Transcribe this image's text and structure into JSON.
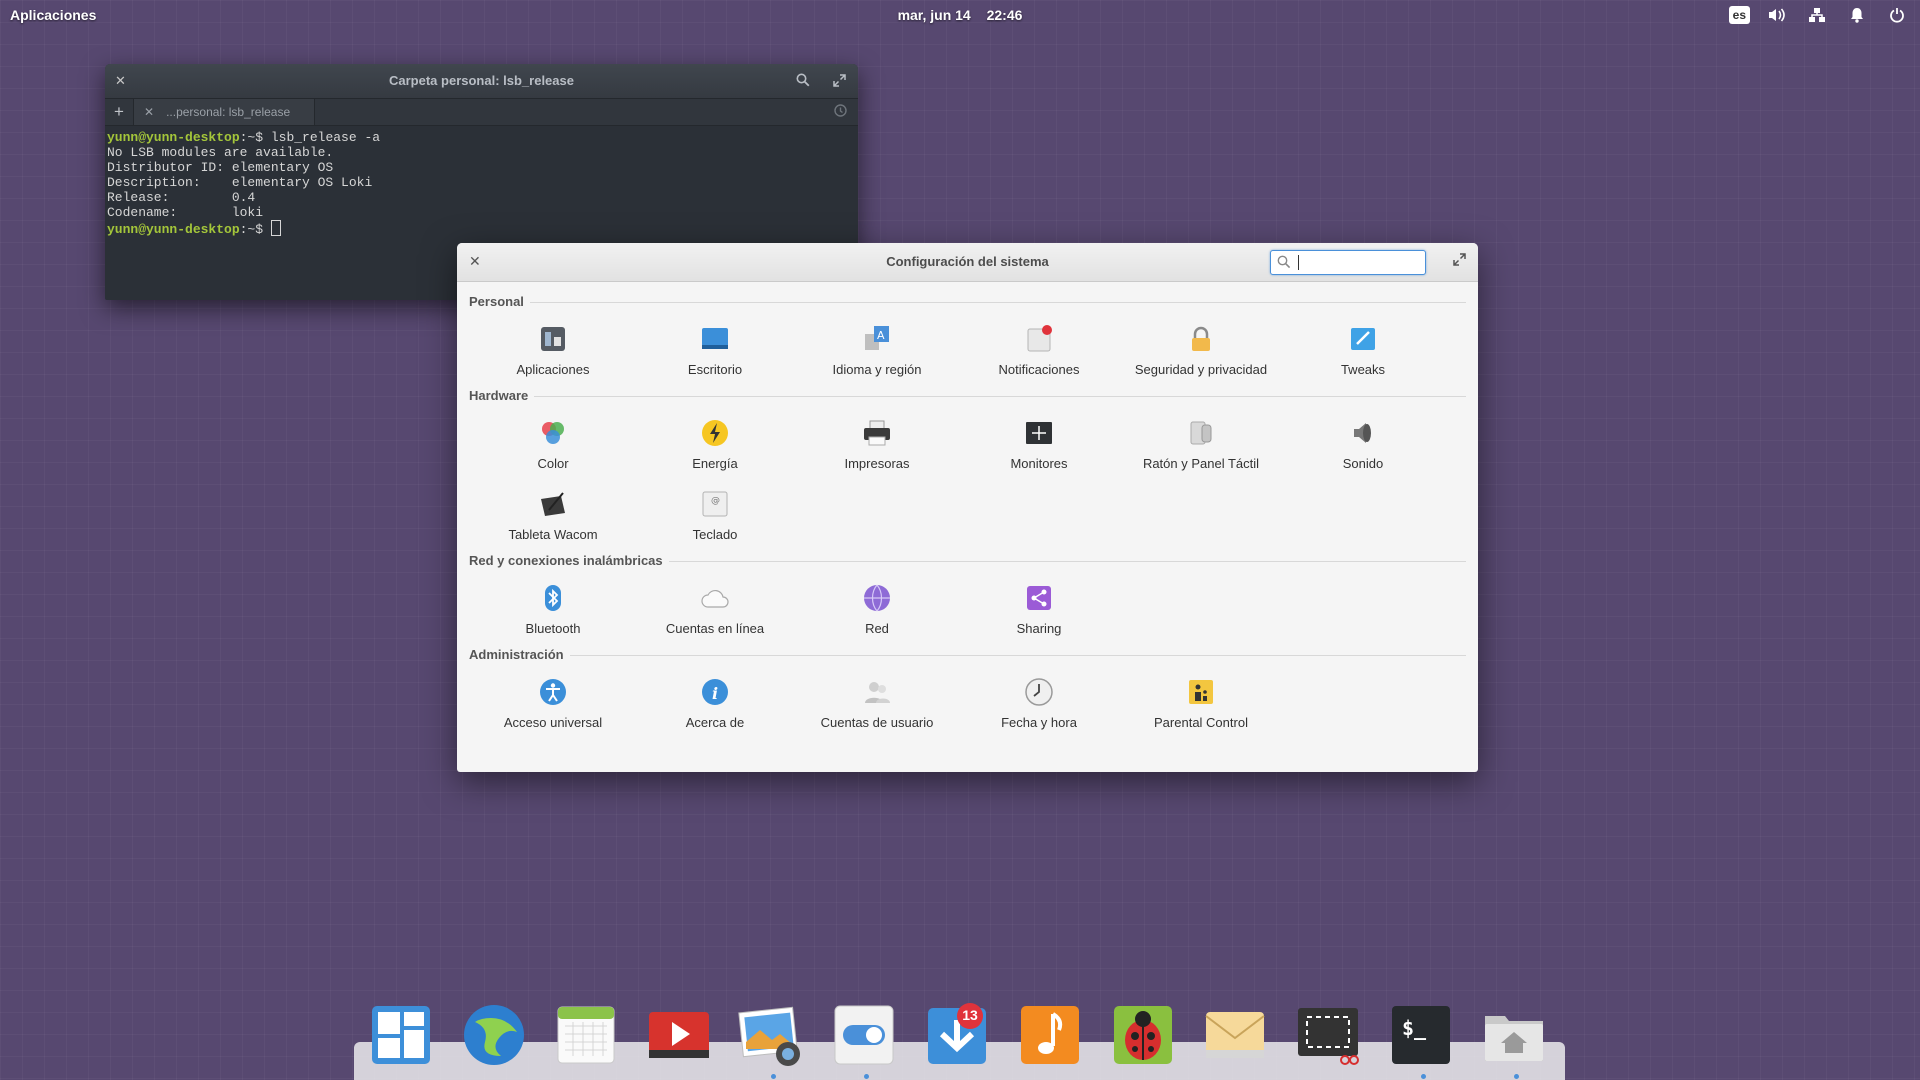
{
  "panel": {
    "applications": "Aplicaciones",
    "date": "mar, jun 14",
    "time": "22:46",
    "keyboard_layout": "es",
    "tray_icons": [
      "volume-icon",
      "network-icon",
      "notifications-icon",
      "power-icon"
    ]
  },
  "terminal": {
    "title": "Carpeta personal: lsb_release",
    "tab_label": "...personal: lsb_release",
    "lines": [
      {
        "prompt": "yunn@yunn-desktop",
        "suffix": ":~$ ",
        "text": "lsb_release -a"
      },
      {
        "text": "No LSB modules are available."
      },
      {
        "text": "Distributor ID:\telementary OS"
      },
      {
        "text": "Description:\telementary OS Loki"
      },
      {
        "text": "Release:\t0.4"
      },
      {
        "text": "Codename:\tloki"
      },
      {
        "prompt": "yunn@yunn-desktop",
        "suffix": ":~$ ",
        "text": ""
      }
    ]
  },
  "settings": {
    "title": "Configuración del sistema",
    "search": {
      "value": "",
      "placeholder": ""
    },
    "categories": [
      {
        "label": "Personal",
        "items": [
          {
            "label": "Aplicaciones",
            "icon": "applications-icon"
          },
          {
            "label": "Escritorio",
            "icon": "desktop-icon"
          },
          {
            "label": "Idioma y región",
            "icon": "language-icon"
          },
          {
            "label": "Notificaciones",
            "icon": "notifications-icon"
          },
          {
            "label": "Seguridad y privacidad",
            "icon": "lock-icon"
          },
          {
            "label": "Tweaks",
            "icon": "tweaks-icon"
          }
        ]
      },
      {
        "label": "Hardware",
        "items": [
          {
            "label": "Color",
            "icon": "color-icon"
          },
          {
            "label": "Energía",
            "icon": "power-icon"
          },
          {
            "label": "Impresoras",
            "icon": "printer-icon"
          },
          {
            "label": "Monitores",
            "icon": "monitor-icon"
          },
          {
            "label": "Ratón y Panel Táctil",
            "icon": "mouse-icon"
          },
          {
            "label": "Sonido",
            "icon": "speaker-icon"
          },
          {
            "label": "Tableta Wacom",
            "icon": "tablet-icon"
          },
          {
            "label": "Teclado",
            "icon": "keyboard-icon"
          }
        ]
      },
      {
        "label": "Red y conexiones inalámbricas",
        "items": [
          {
            "label": "Bluetooth",
            "icon": "bluetooth-icon"
          },
          {
            "label": "Cuentas en línea",
            "icon": "cloud-icon"
          },
          {
            "label": "Red",
            "icon": "globe-icon"
          },
          {
            "label": "Sharing",
            "icon": "share-icon"
          }
        ]
      },
      {
        "label": "Administración",
        "items": [
          {
            "label": "Acceso universal",
            "icon": "accessibility-icon"
          },
          {
            "label": "Acerca de",
            "icon": "info-icon"
          },
          {
            "label": "Cuentas de usuario",
            "icon": "users-icon"
          },
          {
            "label": "Fecha y hora",
            "icon": "clock-icon"
          },
          {
            "label": "Parental Control",
            "icon": "parental-control-icon"
          }
        ]
      }
    ]
  },
  "dock": {
    "items": [
      {
        "name": "multitasking-view",
        "icon": "multitasking-icon"
      },
      {
        "name": "web-browser",
        "icon": "globe-browser-icon"
      },
      {
        "name": "calendar",
        "icon": "calendar-icon"
      },
      {
        "name": "videos",
        "icon": "video-play-icon"
      },
      {
        "name": "photos",
        "icon": "photos-icon"
      },
      {
        "name": "system-settings",
        "icon": "settings-switch-icon"
      },
      {
        "name": "appcenter",
        "icon": "download-icon",
        "badge": "13"
      },
      {
        "name": "music",
        "icon": "music-note-icon"
      },
      {
        "name": "bug-tracker",
        "icon": "ladybug-icon"
      },
      {
        "name": "mail",
        "icon": "envelope-icon"
      },
      {
        "name": "screenshot",
        "icon": "screenshot-icon"
      },
      {
        "name": "terminal",
        "icon": "terminal-icon",
        "label": "$_"
      },
      {
        "name": "files",
        "icon": "home-folder-icon"
      }
    ]
  }
}
